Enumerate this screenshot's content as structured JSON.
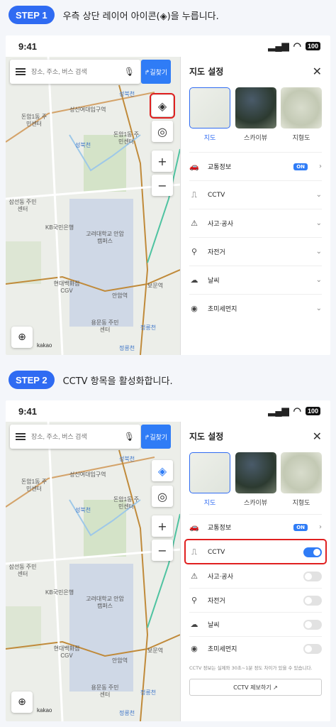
{
  "steps": [
    {
      "badge": "STEP 1",
      "text": "우측 상단 레이어 아이콘(◈)을 누릅니다."
    },
    {
      "badge": "STEP 2",
      "text": "CCTV 항목을 활성화합니다."
    }
  ],
  "status": {
    "time": "9:41",
    "battery": "100"
  },
  "search": {
    "placeholder": "장소, 주소, 버스 검색",
    "directions": "↱길찾기"
  },
  "map_labels": [
    "성북천",
    "성신여대입구역",
    "돈암1동 주민센터",
    "돈암1동 주민센터",
    "성북천",
    "삼선동 주민센터",
    "KB국민은행",
    "고려대학교 안암캠퍼스",
    "현대백화점 CGV",
    "안암역",
    "보문역",
    "용문동 주민센터",
    "정릉천",
    "정릉천",
    "kakao"
  ],
  "panel": {
    "title": "지도 설정",
    "thumbs": [
      "지도",
      "스카이뷰",
      "지형도"
    ],
    "rows": [
      {
        "icon": "car-icon",
        "label": "교통정보",
        "on": "ON"
      },
      {
        "icon": "cctv-icon",
        "label": "CCTV"
      },
      {
        "icon": "warning-icon",
        "label": "사고·공사"
      },
      {
        "icon": "bicycle-icon",
        "label": "자전거"
      },
      {
        "icon": "weather-icon",
        "label": "날씨"
      },
      {
        "icon": "dust-icon",
        "label": "초미세먼지"
      }
    ],
    "note": "CCTV 정보는 실제와 30초~1분 정도 차이가 있을 수 있습니다.",
    "report": "CCTV 제보하기 ↗"
  }
}
